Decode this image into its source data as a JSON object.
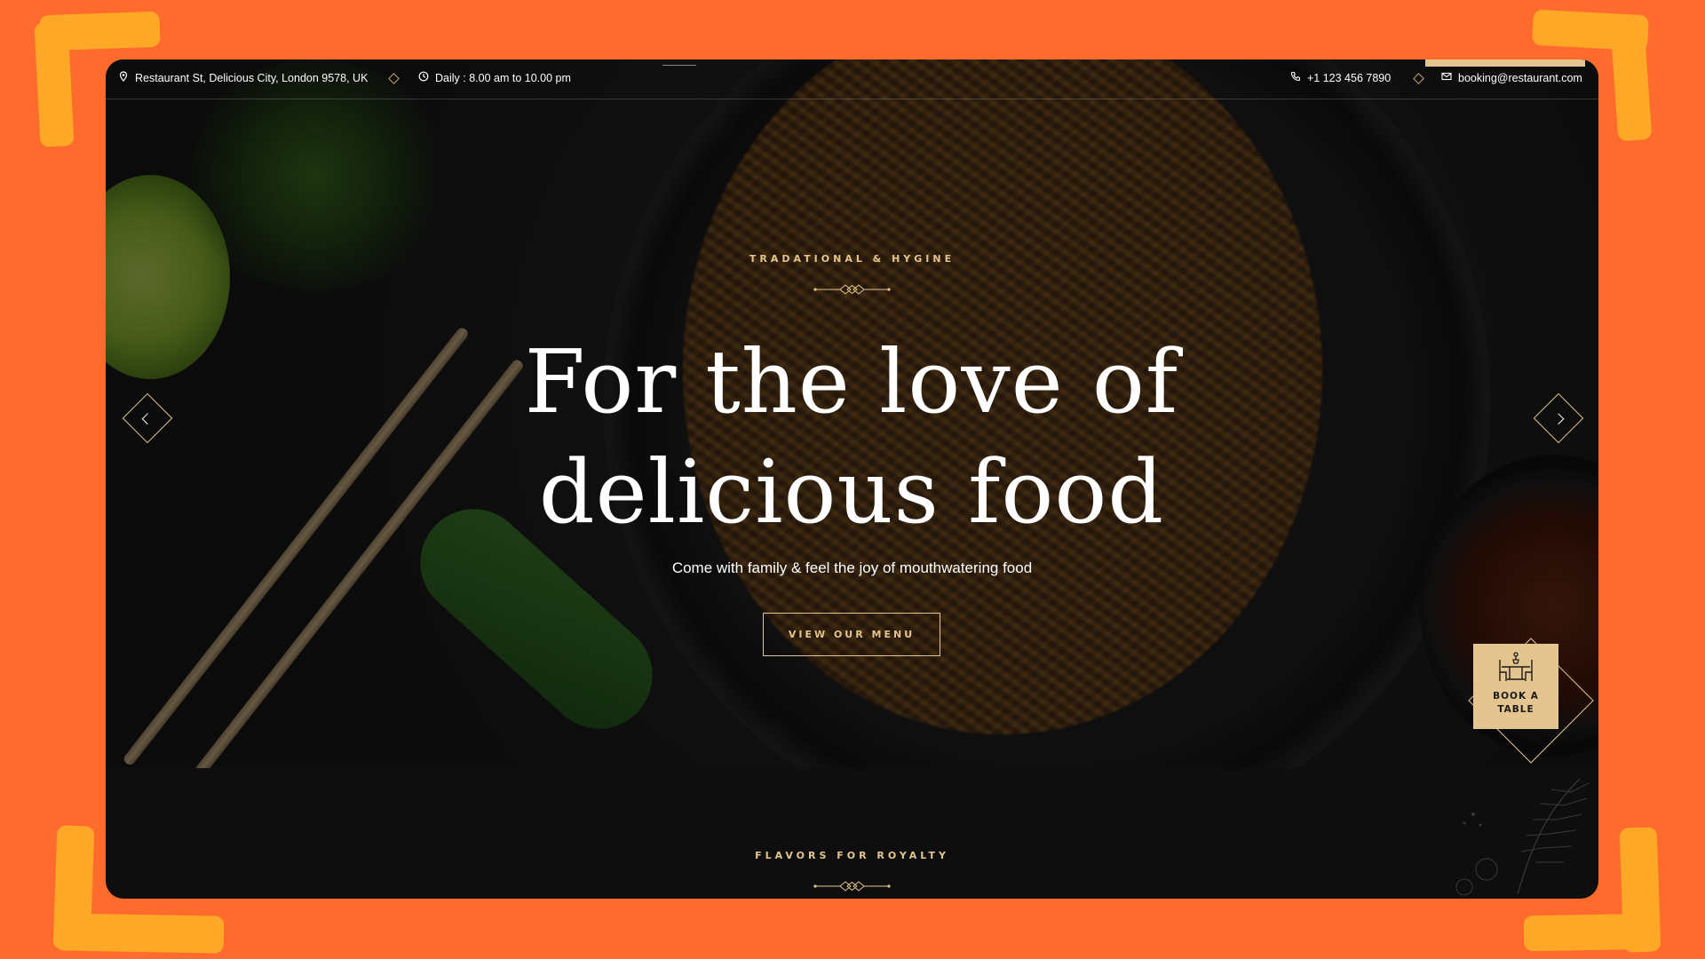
{
  "topbar": {
    "address": "Restaurant St, Delicious City, London 9578, UK",
    "hours": "Daily : 8.00 am to 10.00 pm",
    "phone": "+1 123 456 7890",
    "email": "booking@restaurant.com"
  },
  "hero": {
    "eyebrow": "TRADATIONAL & HYGINE",
    "headline_line1": "For the love of",
    "headline_line2": "delicious food",
    "subheadline": "Come with family & feel the joy of mouthwatering food",
    "cta_label": "VIEW OUR MENU"
  },
  "book_table": {
    "label": "BOOK A TABLE"
  },
  "section": {
    "eyebrow": "FLAVORS FOR ROYALTY"
  },
  "colors": {
    "page_background": "#ff6b2c",
    "bracket_accent": "#ffa726",
    "gold_accent": "#e4c590",
    "dark_background": "#0e0e0e"
  },
  "icons": [
    "map-pin-icon",
    "clock-icon",
    "phone-icon",
    "mail-icon",
    "chevron-left-icon",
    "chevron-right-icon",
    "dining-table-icon"
  ]
}
